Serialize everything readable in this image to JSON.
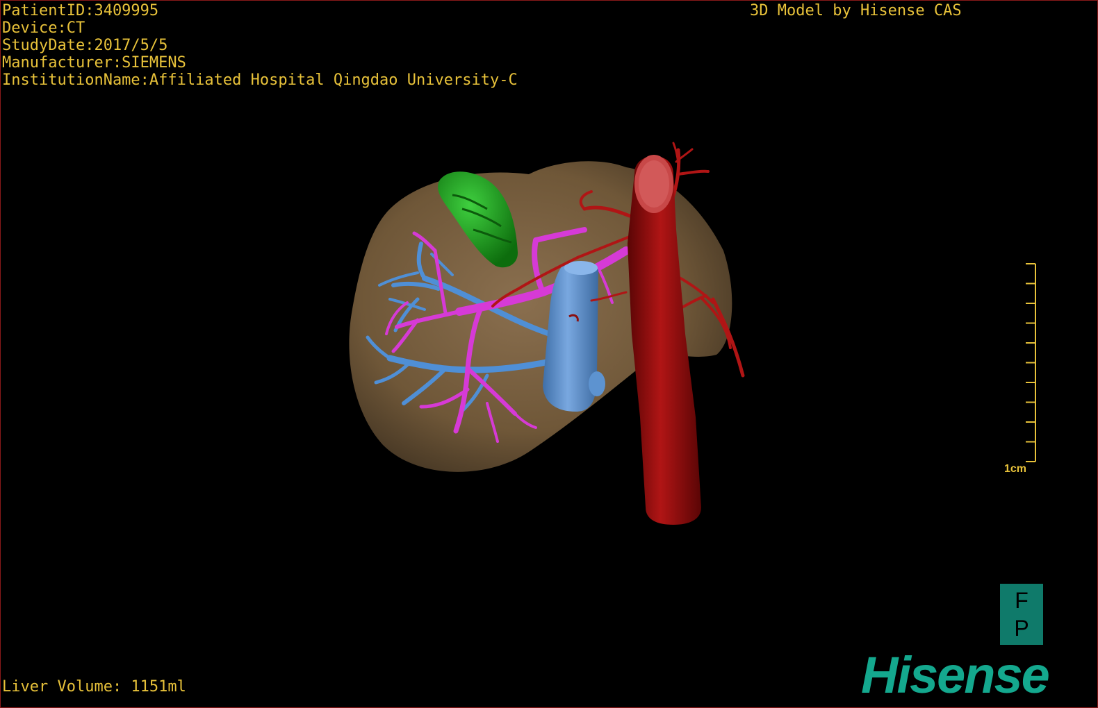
{
  "patient": {
    "id_line": "PatientID:3409995",
    "device_line": "Device:CT",
    "study_date_line": "StudyDate:2017/5/5",
    "manufacturer_line": "Manufacturer:SIEMENS",
    "institution_line": "InstitutionName:Affiliated Hospital Qingdao University-C"
  },
  "header": {
    "brand_title": "3D Model by Hisense CAS"
  },
  "footer": {
    "volume_line": "Liver Volume: 1151ml",
    "logo": "Hisense"
  },
  "scale": {
    "label": "1cm"
  },
  "orientation": {
    "top": "F",
    "bottom": "P"
  },
  "colors": {
    "overlay_text": "#e8c23a",
    "liver": "#7a6245",
    "gallbladder": "#1b9a1b",
    "portal_vein": "#d63ad6",
    "hepatic_vein": "#4f8fd6",
    "ivc": "#5f96d8",
    "aorta": "#9e1010",
    "artery": "#b01515",
    "brand": "#14a88e"
  }
}
